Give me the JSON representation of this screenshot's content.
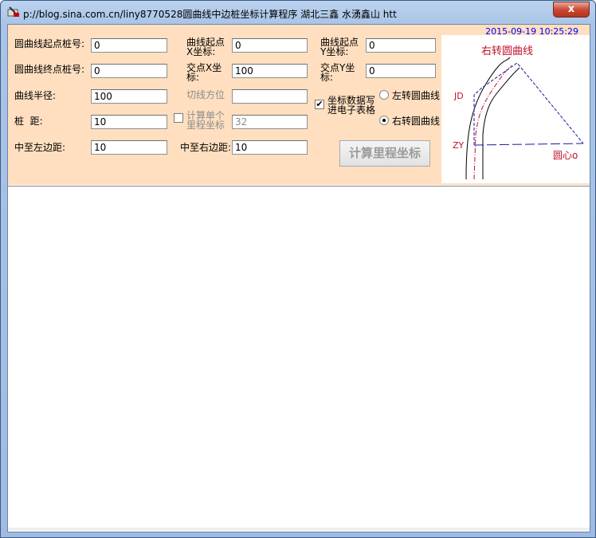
{
  "window": {
    "title": "p://blog.sina.com.cn/liny8770528圆曲线中边桩坐标计算程序    湖北三鑫   水湧鑫山   htt",
    "close": "x"
  },
  "datetime": "2015-09-19 10:25:29",
  "form": {
    "start_station": {
      "label": "圆曲线起点桩号:",
      "value": "0"
    },
    "end_station": {
      "label": "圆曲线终点桩号:",
      "value": "0"
    },
    "radius": {
      "label": "曲线半径:",
      "value": "100"
    },
    "interval": {
      "label": "桩  距:",
      "value": "10"
    },
    "left_offset": {
      "label": "中至左边距:",
      "value": "10"
    },
    "start_x": {
      "label1": "曲线起点",
      "label2": "X坐标:",
      "value": "0"
    },
    "jd_x": {
      "label1": "交点X坐",
      "label2": "标:",
      "value": "100"
    },
    "tangent_azimuth": {
      "label": "切线方位",
      "value": ""
    },
    "single": {
      "label1": "计算单个",
      "label2": "里程坐标",
      "value": "32",
      "checked": false
    },
    "right_offset": {
      "label": "中至右边距:",
      "value": "10"
    },
    "start_y": {
      "label1": "曲线起点",
      "label2": "Y坐标:",
      "value": "0"
    },
    "jd_y": {
      "label1": "交点Y坐",
      "label2": "标:",
      "value": "0"
    },
    "write_excel": {
      "label1": "坐标数据写",
      "label2": "进电子表格",
      "checked": true
    },
    "left_curve": {
      "label": "左转圆曲线",
      "selected": false
    },
    "right_curve": {
      "label": "右转圆曲线",
      "selected": true
    },
    "calc_button": "计算里程坐标"
  },
  "diagram": {
    "title": "右转圆曲线",
    "jd": "JD",
    "zy": "ZY",
    "center": "圆心o"
  }
}
